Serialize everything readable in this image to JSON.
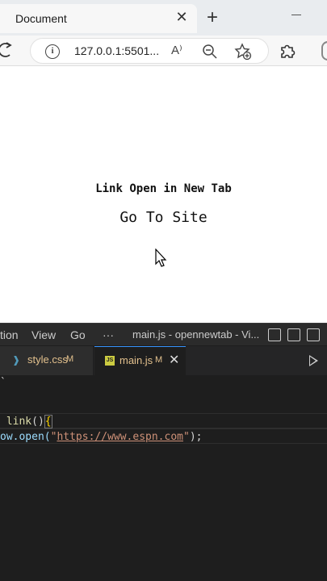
{
  "browser": {
    "tab_title": "Document",
    "tab_close": "✕",
    "new_tab": "+",
    "address_url": "127.0.0.1:5501...",
    "read_aloud_label": "A⁾",
    "info_glyph": "i"
  },
  "page": {
    "heading": "Link Open in New Tab",
    "link_text": "Go To Site"
  },
  "vscode": {
    "menu": {
      "selection": "tion",
      "view": "View",
      "go": "Go",
      "more": "···",
      "window_title": "main.js - opennewtab - Vi..."
    },
    "tabs": [
      {
        "icon": "css-file-icon",
        "name": "style.css",
        "status": "M",
        "active": false
      },
      {
        "icon": "js-file-icon",
        "name": "main.js",
        "status": "M",
        "active": true,
        "close": "✕"
      }
    ],
    "code": {
      "line1_fn": "link",
      "line1_parens": "()",
      "line1_brace": "{",
      "line2_prefix": "ow.open(",
      "line2_quote_open": "\"",
      "line2_string": "https://www.espn.com",
      "line2_quote_close": "\"",
      "line2_suffix": ");"
    },
    "colors": {
      "modified": "#e2c08d",
      "string": "#ce9178",
      "function": "#dcdcaa",
      "accent": "#3794ff"
    }
  }
}
